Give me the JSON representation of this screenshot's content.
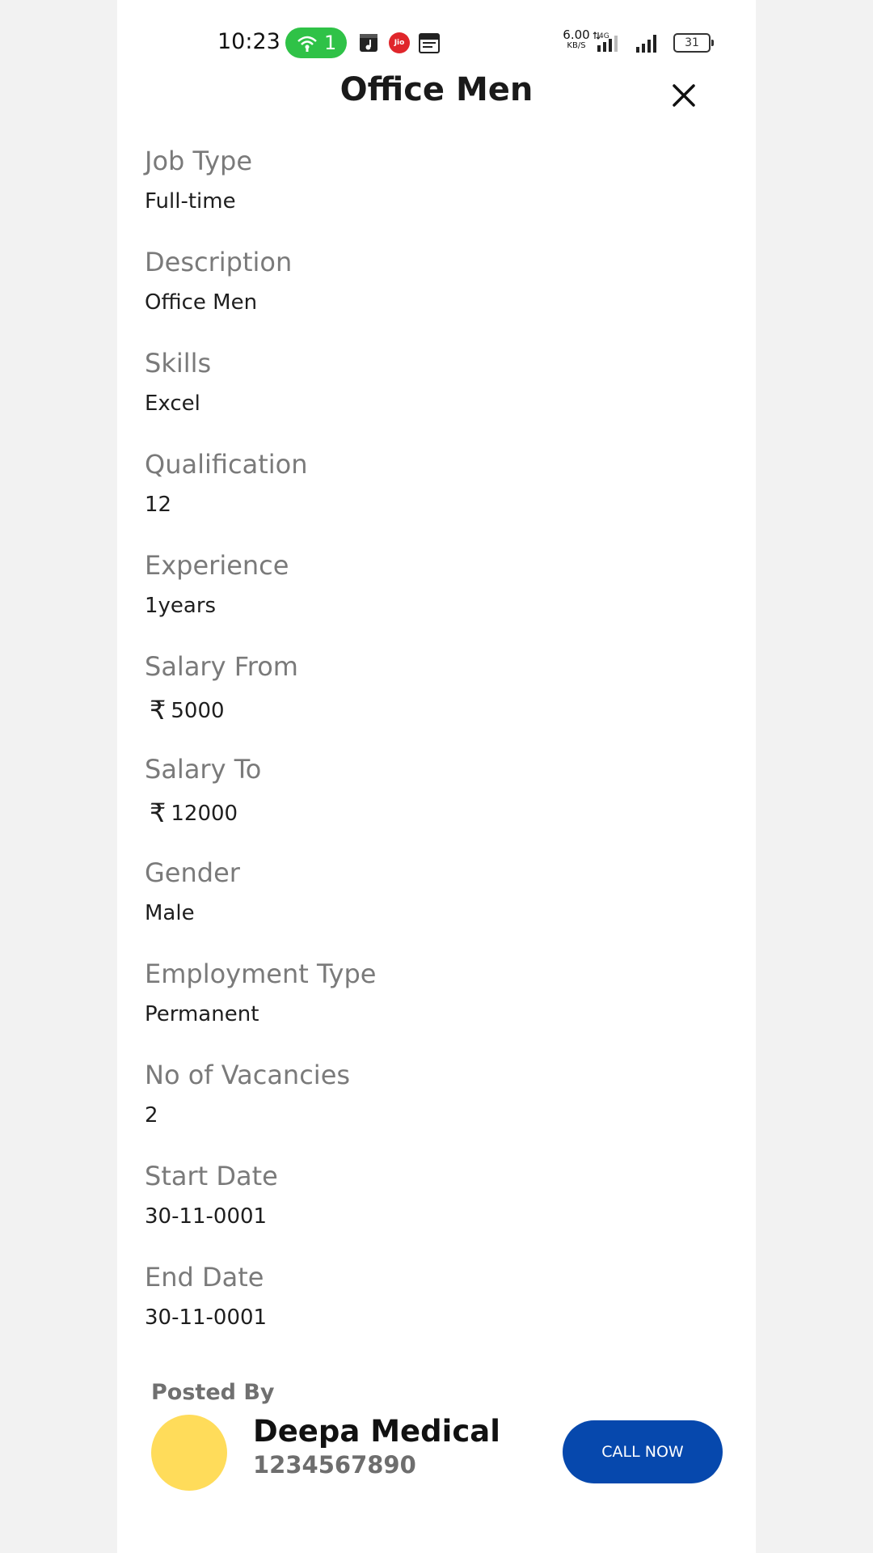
{
  "status_bar": {
    "time": "10:23",
    "hotspot_count": "1",
    "jio_label": "Jio",
    "net_speed_value": "6.00",
    "net_speed_unit": "KB/S",
    "network_type": "4G",
    "battery": "31",
    "colors": {
      "hotspot": "#2fc247",
      "jio": "#e0262b"
    }
  },
  "header": {
    "title": "Office Men",
    "close_icon": "close-icon"
  },
  "fields": [
    {
      "label": "Job Type",
      "value": "Full-time"
    },
    {
      "label": "Description",
      "value": "Office Men"
    },
    {
      "label": "Skills",
      "value": "Excel"
    },
    {
      "label": "Qualification",
      "value": "12"
    },
    {
      "label": "Experience",
      "value": "1years"
    },
    {
      "label": "Salary From",
      "currency": "₹",
      "value": "5000"
    },
    {
      "label": "Salary To",
      "currency": "₹",
      "value": "12000"
    },
    {
      "label": "Gender",
      "value": "Male"
    },
    {
      "label": "Employment Type",
      "value": "Permanent"
    },
    {
      "label": "No of Vacancies",
      "value": "2"
    },
    {
      "label": "Start Date",
      "value": "30-11-0001"
    },
    {
      "label": "End Date",
      "value": "30-11-0001"
    }
  ],
  "posted_by": {
    "label": "Posted By",
    "name": "Deepa Medical",
    "phone": "1234567890",
    "avatar_color": "#ffdc5a"
  },
  "call_button": {
    "label": "CALL NOW",
    "color": "#0648ad"
  }
}
